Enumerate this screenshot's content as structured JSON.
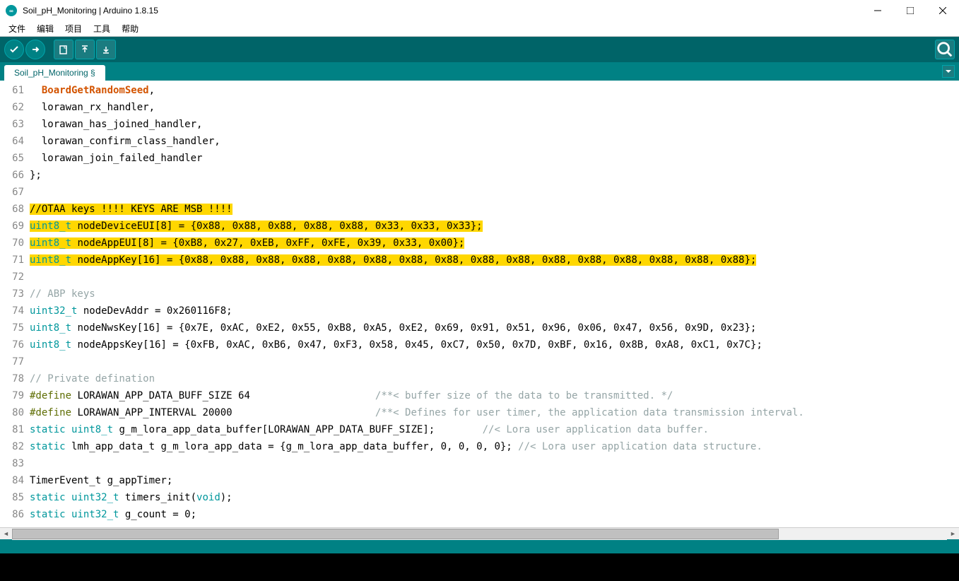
{
  "window": {
    "title": "Soil_pH_Monitoring | Arduino 1.8.15"
  },
  "menu": {
    "file": "文件",
    "edit": "编辑",
    "sketch": "项目",
    "tools": "工具",
    "help": "帮助"
  },
  "tab": {
    "name": "Soil_pH_Monitoring §"
  },
  "code": {
    "lines": [
      {
        "n": 61,
        "hl": false,
        "segs": [
          {
            "t": "  "
          },
          {
            "t": "BoardGetRandomSeed",
            "c": "kw-orange"
          },
          {
            "t": ","
          }
        ]
      },
      {
        "n": 62,
        "hl": false,
        "segs": [
          {
            "t": "  lorawan_rx_handler,"
          }
        ]
      },
      {
        "n": 63,
        "hl": false,
        "segs": [
          {
            "t": "  lorawan_has_joined_handler,"
          }
        ]
      },
      {
        "n": 64,
        "hl": false,
        "segs": [
          {
            "t": "  lorawan_confirm_class_handler,"
          }
        ]
      },
      {
        "n": 65,
        "hl": false,
        "segs": [
          {
            "t": "  lorawan_join_failed_handler"
          }
        ]
      },
      {
        "n": 66,
        "hl": false,
        "segs": [
          {
            "t": "};"
          }
        ]
      },
      {
        "n": 67,
        "hl": false,
        "segs": [
          {
            "t": ""
          }
        ]
      },
      {
        "n": 68,
        "hl": true,
        "segs": [
          {
            "t": "//OTAA keys !!!! KEYS ARE MSB !!!!"
          }
        ]
      },
      {
        "n": 69,
        "hl": true,
        "segs": [
          {
            "t": "uint8_t",
            "c": "kw-teal"
          },
          {
            "t": " nodeDeviceEUI[8] = {0x88, 0x88, 0x88, 0x88, 0x88, 0x33, 0x33, 0x33};"
          }
        ]
      },
      {
        "n": 70,
        "hl": true,
        "segs": [
          {
            "t": "uint8_t",
            "c": "kw-teal"
          },
          {
            "t": " nodeAppEUI[8] = {0xB8, 0x27, 0xEB, 0xFF, 0xFE, 0x39, 0x33, 0x00};"
          }
        ]
      },
      {
        "n": 71,
        "hl": true,
        "segs": [
          {
            "t": "uint8_t",
            "c": "kw-teal"
          },
          {
            "t": " nodeAppKey[16] = {0x88, 0x88, 0x88, 0x88, 0x88, 0x88, 0x88, 0x88, 0x88, 0x88, 0x88, 0x88, 0x88, 0x88, 0x88, 0x88};"
          }
        ]
      },
      {
        "n": 72,
        "hl": false,
        "segs": [
          {
            "t": ""
          }
        ]
      },
      {
        "n": 73,
        "hl": false,
        "segs": [
          {
            "t": "// ABP keys",
            "c": "comment"
          }
        ]
      },
      {
        "n": 74,
        "hl": false,
        "segs": [
          {
            "t": "uint32_t",
            "c": "kw-teal"
          },
          {
            "t": " nodeDevAddr = 0x260116F8;"
          }
        ]
      },
      {
        "n": 75,
        "hl": false,
        "segs": [
          {
            "t": "uint8_t",
            "c": "kw-teal"
          },
          {
            "t": " nodeNwsKey[16] = {0x7E, 0xAC, 0xE2, 0x55, 0xB8, 0xA5, 0xE2, 0x69, 0x91, 0x51, 0x96, 0x06, 0x47, 0x56, 0x9D, 0x23};"
          }
        ]
      },
      {
        "n": 76,
        "hl": false,
        "segs": [
          {
            "t": "uint8_t",
            "c": "kw-teal"
          },
          {
            "t": " nodeAppsKey[16] = {0xFB, 0xAC, 0xB6, 0x47, 0xF3, 0x58, 0x45, 0xC7, 0x50, 0x7D, 0xBF, 0x16, 0x8B, 0xA8, 0xC1, 0x7C};"
          }
        ]
      },
      {
        "n": 77,
        "hl": false,
        "segs": [
          {
            "t": ""
          }
        ]
      },
      {
        "n": 78,
        "hl": false,
        "segs": [
          {
            "t": "// Private defination",
            "c": "comment"
          }
        ]
      },
      {
        "n": 79,
        "hl": false,
        "segs": [
          {
            "t": "#define",
            "c": "kw-green"
          },
          {
            "t": " LORAWAN_APP_DATA_BUFF_SIZE 64                     "
          },
          {
            "t": "/**< buffer size of the data to be transmitted. */",
            "c": "comment"
          }
        ]
      },
      {
        "n": 80,
        "hl": false,
        "segs": [
          {
            "t": "#define",
            "c": "kw-green"
          },
          {
            "t": " LORAWAN_APP_INTERVAL 20000                        "
          },
          {
            "t": "/**< Defines for user timer, the application data transmission interval. ",
            "c": "comment"
          }
        ]
      },
      {
        "n": 81,
        "hl": false,
        "segs": [
          {
            "t": "static",
            "c": "kw-teal"
          },
          {
            "t": " "
          },
          {
            "t": "uint8_t",
            "c": "kw-teal"
          },
          {
            "t": " g_m_lora_app_data_buffer[LORAWAN_APP_DATA_BUFF_SIZE];        "
          },
          {
            "t": "//< Lora user application data buffer.",
            "c": "comment"
          }
        ]
      },
      {
        "n": 82,
        "hl": false,
        "segs": [
          {
            "t": "static",
            "c": "kw-teal"
          },
          {
            "t": " lmh_app_data_t g_m_lora_app_data = {g_m_lora_app_data_buffer, 0, 0, 0, 0}; "
          },
          {
            "t": "//< Lora user application data structure.",
            "c": "comment"
          }
        ]
      },
      {
        "n": 83,
        "hl": false,
        "segs": [
          {
            "t": ""
          }
        ]
      },
      {
        "n": 84,
        "hl": false,
        "segs": [
          {
            "t": "TimerEvent_t g_appTimer;"
          }
        ]
      },
      {
        "n": 85,
        "hl": false,
        "segs": [
          {
            "t": "static",
            "c": "kw-teal"
          },
          {
            "t": " "
          },
          {
            "t": "uint32_t",
            "c": "kw-teal"
          },
          {
            "t": " timers_init("
          },
          {
            "t": "void",
            "c": "kw-teal"
          },
          {
            "t": ");"
          }
        ]
      },
      {
        "n": 86,
        "hl": false,
        "segs": [
          {
            "t": "static",
            "c": "kw-teal"
          },
          {
            "t": " "
          },
          {
            "t": "uint32_t",
            "c": "kw-teal"
          },
          {
            "t": " g_count = 0;"
          }
        ]
      }
    ]
  }
}
